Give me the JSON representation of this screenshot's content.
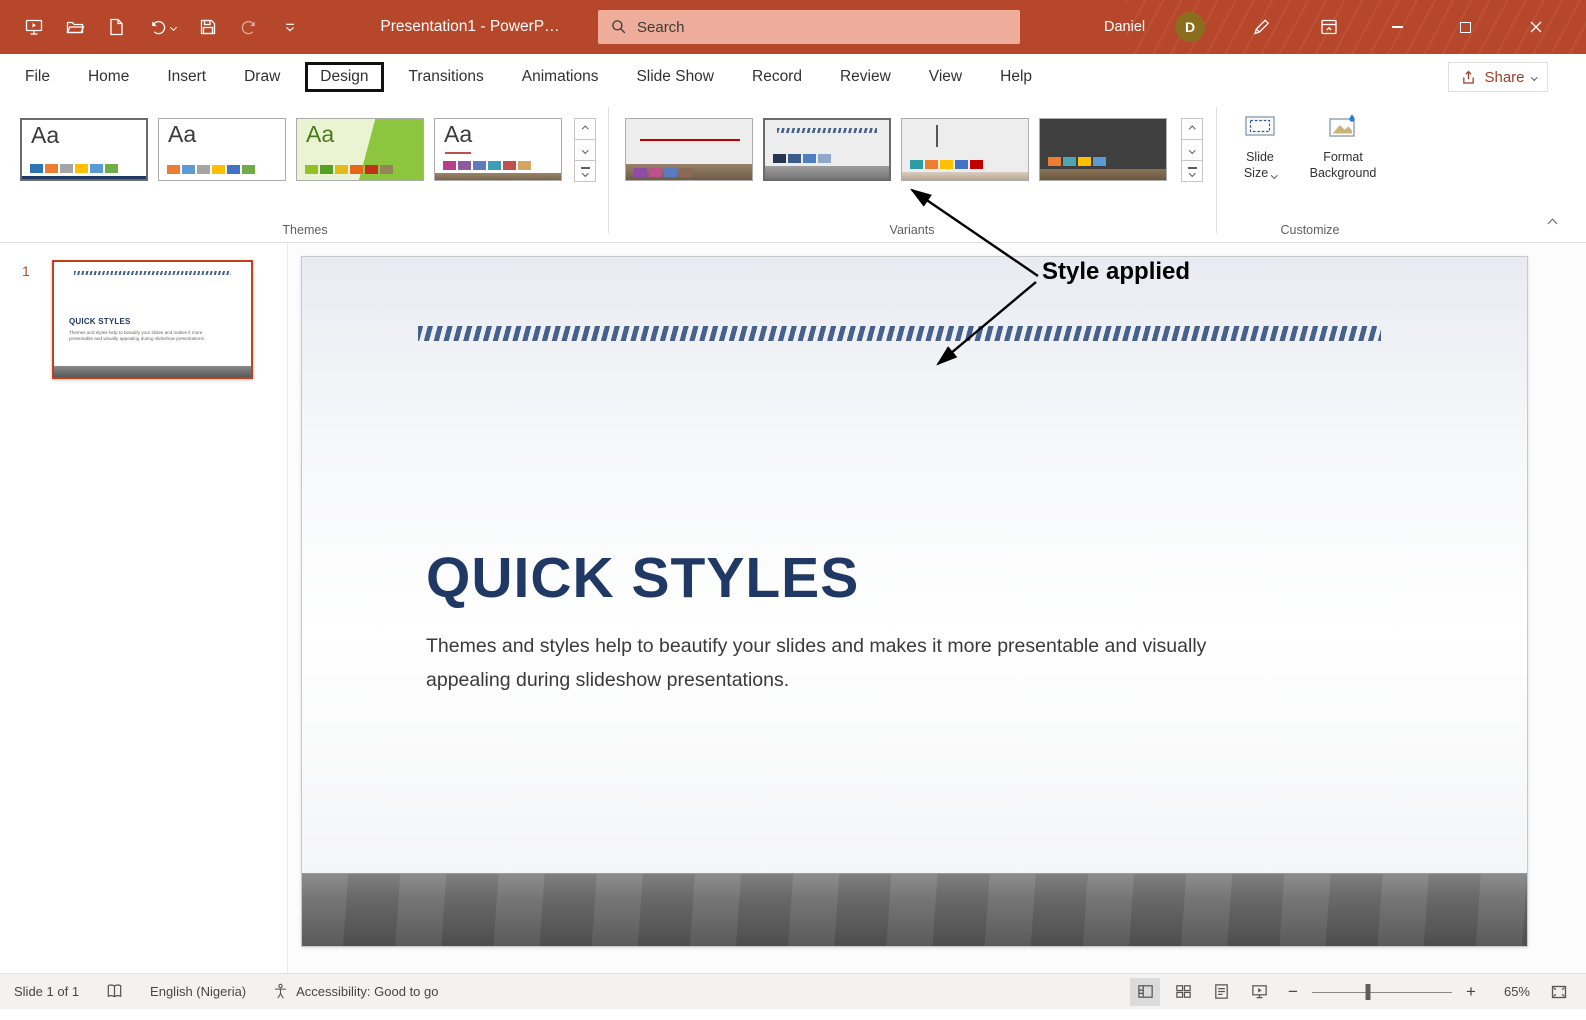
{
  "title_bar": {
    "app_title": "Presentation1  -  PowerP…",
    "search_placeholder": "Search",
    "user_name": "Daniel",
    "user_initial": "D"
  },
  "tabs": {
    "items": [
      "File",
      "Home",
      "Insert",
      "Draw",
      "Design",
      "Transitions",
      "Animations",
      "Slide Show",
      "Record",
      "Review",
      "View",
      "Help"
    ],
    "active": "Design",
    "share_label": "Share"
  },
  "ribbon": {
    "themes_group_label": "Themes",
    "variants_group_label": "Variants",
    "customize_group_label": "Customize",
    "theme_glyph": "Aa",
    "themes": [
      {
        "name": "theme-1",
        "swatches": [
          "#2E75B6",
          "#ED7D31",
          "#A5A5A5",
          "#FFC000",
          "#5B9BD5",
          "#70AD47"
        ]
      },
      {
        "name": "theme-2",
        "swatches": [
          "#ED7D31",
          "#5B9BD5",
          "#A5A5A5",
          "#FFC000",
          "#4472C4",
          "#70AD47"
        ]
      },
      {
        "name": "theme-3",
        "swatches": [
          "#90C226",
          "#54A021",
          "#E6B91E",
          "#E76618",
          "#C42F1A",
          "#918655"
        ]
      },
      {
        "name": "theme-4",
        "swatches": [
          "#B83D8A",
          "#8C5B9E",
          "#5E7BC0",
          "#3BA0B5",
          "#C0504D",
          "#D6A461"
        ]
      }
    ],
    "variants": [
      {
        "name": "variant-1",
        "selected": false,
        "swatches": [
          "#8E4CA8",
          "#C0508A",
          "#5B7BC0",
          "#8A6A52"
        ]
      },
      {
        "name": "variant-2",
        "selected": true,
        "swatches": [
          "#26354F",
          "#3C5A8C",
          "#4E7FBF",
          "#8FA8C8"
        ]
      },
      {
        "name": "variant-3",
        "selected": false,
        "swatches": [
          "#2E9BA6",
          "#ED7D31",
          "#FFC000",
          "#4472C4",
          "#C00000"
        ]
      },
      {
        "name": "variant-4",
        "selected": false,
        "swatches": [
          "#ED7D31",
          "#4EA6B5",
          "#FFC000",
          "#5B9BD5"
        ]
      }
    ],
    "slide_size_label": "Slide Size",
    "format_background_label": "Format Background"
  },
  "annotation": {
    "label": "Style applied"
  },
  "slides_panel": {
    "slide_number": "1"
  },
  "slide": {
    "title": "QUICK STYLES",
    "body": "Themes and styles help to beautify your slides and makes it more presentable and visually appealing during slideshow presentations."
  },
  "status_bar": {
    "slide_indicator": "Slide 1 of 1",
    "language": "English (Nigeria)",
    "accessibility": "Accessibility: Good to go",
    "zoom_level": "65%"
  },
  "colors": {
    "titlebar_red": "#B7472A",
    "search_box": "#EEAD9B",
    "slide_title_navy": "#1F3864",
    "selected_thumbnail_border": "#C43E1C",
    "avatar_bg": "#8A6D1D"
  }
}
